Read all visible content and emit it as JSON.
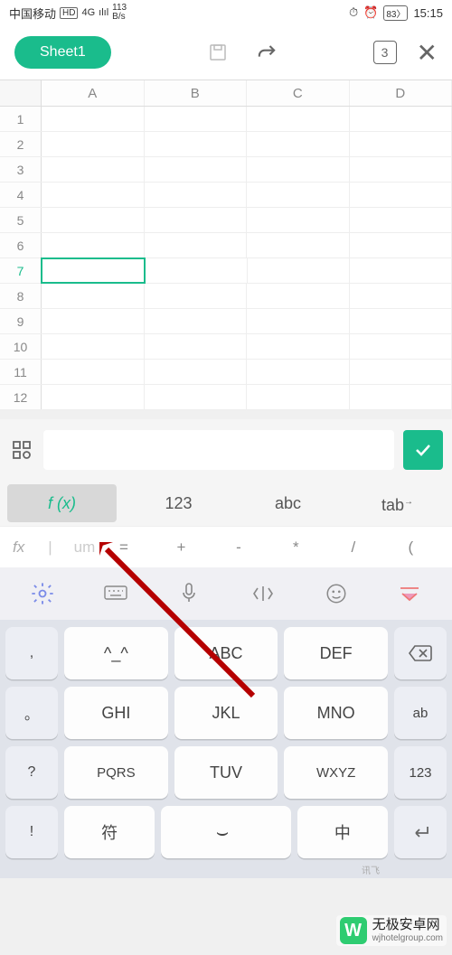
{
  "status": {
    "carrier": "中国移动",
    "hd": "HD",
    "net_gen": "4G",
    "signal": "ılıl",
    "speed_top": "113",
    "speed_bot": "B/s",
    "alarm": "⏱",
    "alarm2": "⏰",
    "battery": "83",
    "time": "15:15"
  },
  "toolbar": {
    "sheet": "Sheet1",
    "pages": "3"
  },
  "columns": [
    "A",
    "B",
    "C",
    "D"
  ],
  "rows": [
    "1",
    "2",
    "3",
    "4",
    "5",
    "6",
    "7",
    "8",
    "9",
    "10",
    "11",
    "12"
  ],
  "selected_row": 7,
  "modes": {
    "fx": "f (x)",
    "num": "123",
    "abc": "abc",
    "tab": "tab"
  },
  "fn": {
    "label": "fx",
    "hint": "um",
    "ops": [
      "=",
      "+",
      "-",
      "*",
      "/",
      "("
    ]
  },
  "kb": {
    "r1": {
      "side": ",",
      "k1": "^_^",
      "k2": "ABC",
      "k3": "DEF"
    },
    "r2": {
      "side": "。",
      "k1": "GHI",
      "k2": "JKL",
      "k3": "MNO",
      "end": "ab"
    },
    "r3": {
      "side": "?",
      "k1": "PQRS",
      "k2": "TUV",
      "k3": "WXYZ",
      "end": "123"
    },
    "r4": {
      "side": "!",
      "k1": "符",
      "k2": "中"
    },
    "brand": "讯飞"
  },
  "wm": {
    "logo": "W",
    "title": "无极安卓网",
    "url": "wjhotelgroup.com"
  }
}
